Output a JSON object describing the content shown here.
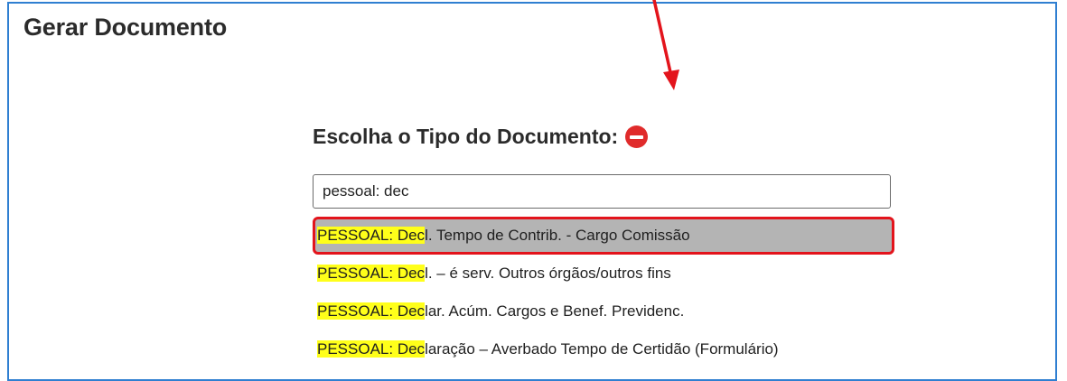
{
  "page": {
    "title": "Gerar Documento"
  },
  "section": {
    "title": "Escolha o Tipo do Documento:"
  },
  "search": {
    "value": "pessoal: dec"
  },
  "results": [
    {
      "match": "PESSOAL: Dec",
      "rest": "l. Tempo de Contrib. - Cargo Comissão",
      "selected": true
    },
    {
      "match": "PESSOAL: Dec",
      "rest": "l. – é serv. Outros órgãos/outros fins",
      "selected": false
    },
    {
      "match": "PESSOAL: Dec",
      "rest": "lar. Acúm. Cargos e Benef. Previdenc.",
      "selected": false
    },
    {
      "match": "PESSOAL: Dec",
      "rest": "laração – Averbado Tempo de Certidão (Formulário)",
      "selected": false
    }
  ],
  "icons": {
    "remove": "minus-circle-icon",
    "annotation": "red-arrow-icon"
  },
  "colors": {
    "frame_border": "#2f7fd1",
    "highlight": "#ffff1a",
    "selected_bg": "#b4b4b4",
    "selected_border": "#e3141c",
    "remove_icon": "#e02b2b",
    "annotation_arrow": "#e3141c"
  }
}
